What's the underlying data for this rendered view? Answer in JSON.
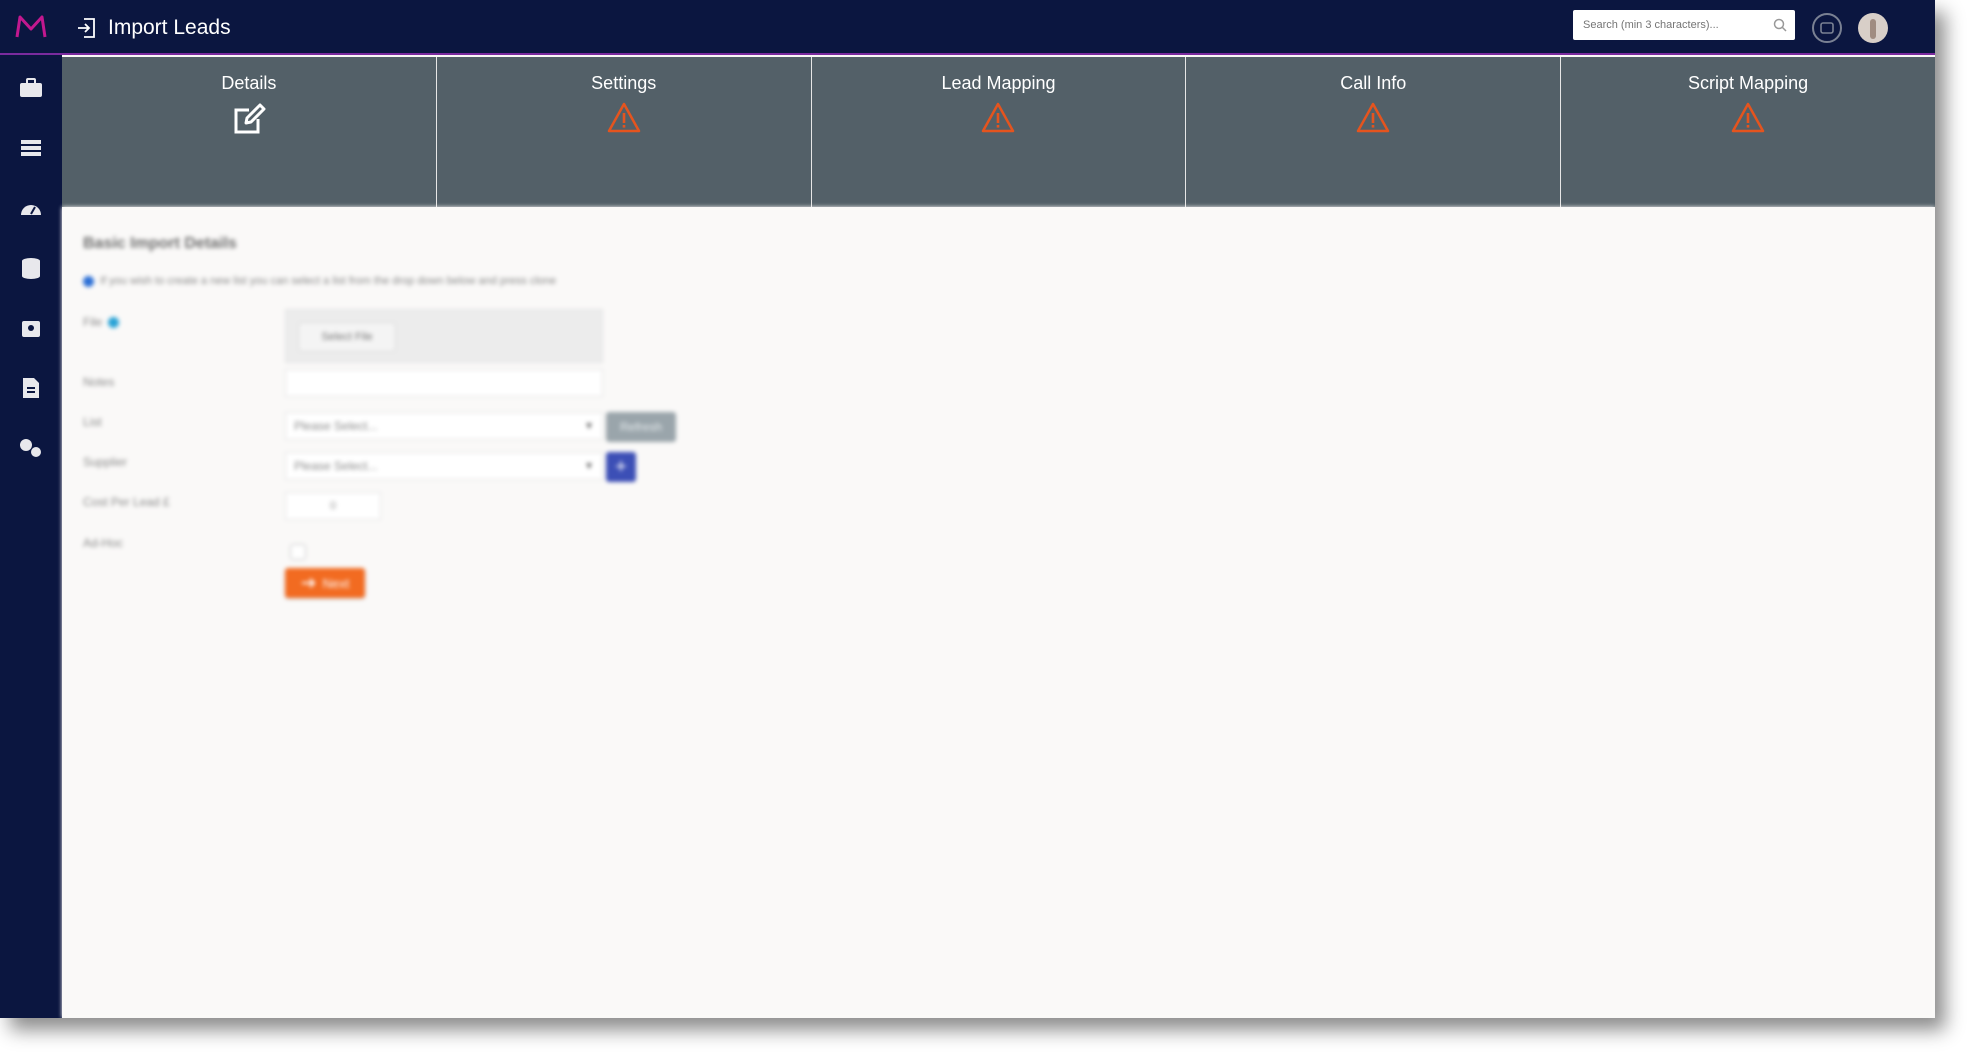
{
  "header": {
    "title": "Import Leads",
    "search_placeholder": "Search (min 3 characters)...",
    "colors": {
      "bar": "#0b1640",
      "accent": "#c2188f"
    }
  },
  "sidebar": {
    "items": [
      {
        "icon": "briefcase-icon"
      },
      {
        "icon": "list-icon"
      },
      {
        "icon": "dashboard-icon"
      },
      {
        "icon": "database-icon"
      },
      {
        "icon": "contacts-icon"
      },
      {
        "icon": "document-icon"
      },
      {
        "icon": "settings-icon"
      }
    ]
  },
  "tabs": [
    {
      "label": "Details",
      "status": "edit"
    },
    {
      "label": "Settings",
      "status": "warning"
    },
    {
      "label": "Lead Mapping",
      "status": "warning"
    },
    {
      "label": "Call Info",
      "status": "warning"
    },
    {
      "label": "Script Mapping",
      "status": "warning"
    }
  ],
  "form": {
    "section_title": "Basic Import Details",
    "info_text": "If you wish to create a new list you can select a list from the drop down below and press clone",
    "file_label": "File",
    "select_file_label": "Select File",
    "notes_label": "Notes",
    "notes_value": "",
    "list_label": "List",
    "list_value": "Please Select...",
    "refresh_label": "Refresh",
    "supplier_label": "Supplier",
    "supplier_value": "Please Select...",
    "add_supplier_label": "+",
    "cost_label": "Cost Per Lead £",
    "cost_value": "0",
    "ad_hoc_label": "Ad-Hoc",
    "next_label": "Next",
    "colors": {
      "next": "#f26b21",
      "plus": "#3c4fb6",
      "warning": "#e5541e"
    }
  }
}
